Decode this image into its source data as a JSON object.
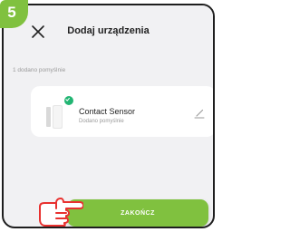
{
  "step": {
    "number": "5"
  },
  "header": {
    "title": "Dodaj urządzenia",
    "close_icon": "close-icon"
  },
  "summary": {
    "count_text": "1 dodano pomyślnie"
  },
  "device": {
    "name": "Contact Sensor",
    "status": "Dodano pomyślnie",
    "icon": "contact-sensor-icon",
    "badge_icon": "check-icon",
    "edit_icon": "edit-pencil-icon"
  },
  "actions": {
    "finish_label": "ZAKOŃCZ"
  },
  "colors": {
    "accent": "#80c13f",
    "success": "#22b573"
  }
}
